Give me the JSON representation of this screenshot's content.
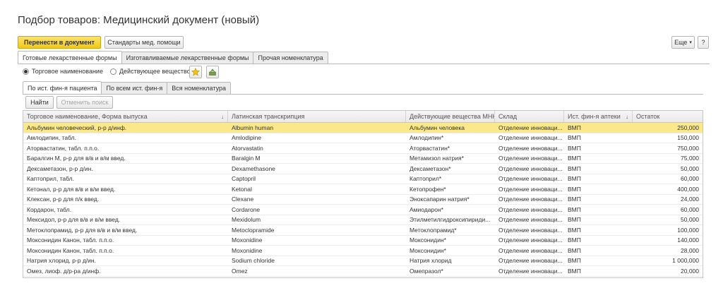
{
  "window": {
    "title": "Подбор товаров: Медицинский документ (новый)"
  },
  "toolbar": {
    "transfer_label": "Перенести в документ",
    "standards_label": "Стандарты мед. помощи",
    "more_label": "Еще",
    "help_label": "?"
  },
  "top_tabs": [
    {
      "label": "Готовые лекарственные формы",
      "active": true
    },
    {
      "label": "Изготавливаемые лекарственные формы",
      "active": false
    },
    {
      "label": "Прочая номенклатура",
      "active": false
    }
  ],
  "search_mode": {
    "option1": "Торговое наименование",
    "option2": "Действующее вещество",
    "selected": "option1",
    "star_icon": "star-icon",
    "basket_icon": "basket-icon"
  },
  "sub_tabs": [
    {
      "label": "По ист. фин-я пациента",
      "active": true
    },
    {
      "label": "По всем ист. фин-я",
      "active": false
    },
    {
      "label": "Вся номенклатура",
      "active": false
    }
  ],
  "search": {
    "find_label": "Найти",
    "cancel_label": "Отменить поиск"
  },
  "table": {
    "columns": [
      "Торговое наименование, Форма выпуска",
      "Латинская транскрипция",
      "Действующие вещества МНН",
      "Склад",
      "Ист. фин-я аптеки",
      "Остаток"
    ],
    "rows": [
      [
        "Альбумин человеческий, р-р д/инф.",
        "Albumin human",
        "Альбумин человека",
        "Отделение инноваци...",
        "ВМП",
        "250,000"
      ],
      [
        "Амлодипин, табл.",
        "Amlodipine",
        "Амлодипин*",
        "Отделение инноваци...",
        "ВМП",
        "150,000"
      ],
      [
        "Аторвастатин, табл. п.п.о.",
        "Atorvastatin",
        "Аторвастатин*",
        "Отделение инноваци...",
        "ВМП",
        "750,000"
      ],
      [
        "Баралгин М, р-р для в/в и в/м введ.",
        "Baralgin M",
        "Метамизол натрия*",
        "Отделение инноваци...",
        "ВМП",
        "75,000"
      ],
      [
        "Дексаметазон, р-р д/ин.",
        "Dexamethasone",
        "Дексаметазон*",
        "Отделение инноваци...",
        "ВМП",
        "50,000"
      ],
      [
        "Каптоприл, табл.",
        "Captopril",
        "Каптоприл*",
        "Отделение инноваци...",
        "ВМП",
        "60,000"
      ],
      [
        "Кетонал, р-р для в/в и в/м введ.",
        "Ketonal",
        "Кетопрофен*",
        "Отделение инноваци...",
        "ВМП",
        "400,000"
      ],
      [
        "Клексан, р-р для п/к введ.",
        "Clexane",
        "Эноксапарин натрия*",
        "Отделение инноваци...",
        "ВМП",
        "24,000"
      ],
      [
        "Кордарон, табл.",
        "Cordarone",
        "Амиодарон*",
        "Отделение инноваци...",
        "ВМП",
        "60,000"
      ],
      [
        "Мексидол, р-р для в/в и в/м введ.",
        "Mexidolum",
        "Этилметилгидроксипириди...",
        "Отделение инноваци...",
        "ВМП",
        "50,000"
      ],
      [
        "Метоклопрамид, р-р для в/в и в/м введ.",
        "Metoclopramide",
        "Метоклопрамид*",
        "Отделение инноваци...",
        "ВМП",
        "100,000"
      ],
      [
        "Моксонидин Канон, табл. п.п.о.",
        "Moxonidine",
        "Моксонидин*",
        "Отделение инноваци...",
        "ВМП",
        "140,000"
      ],
      [
        "Моксонидин Канон, табл. п.п.о.",
        "Moxonidine",
        "Моксонидин*",
        "Отделение инноваци...",
        "ВМП",
        "28,000"
      ],
      [
        "Натрия хлорид, р-р д/ин.",
        "Sodium chloride",
        "Натрия хлорид",
        "Отделение инноваци...",
        "ВМП",
        "1 000,000"
      ],
      [
        "Омез, лиоф. д/р-ра д/инф.",
        "Omez",
        "Омепразол*",
        "Отделение инноваци...",
        "ВМП",
        "20,000"
      ]
    ]
  },
  "colors": {
    "accent": "#f1c814",
    "selected_row": "#fbe88a"
  }
}
